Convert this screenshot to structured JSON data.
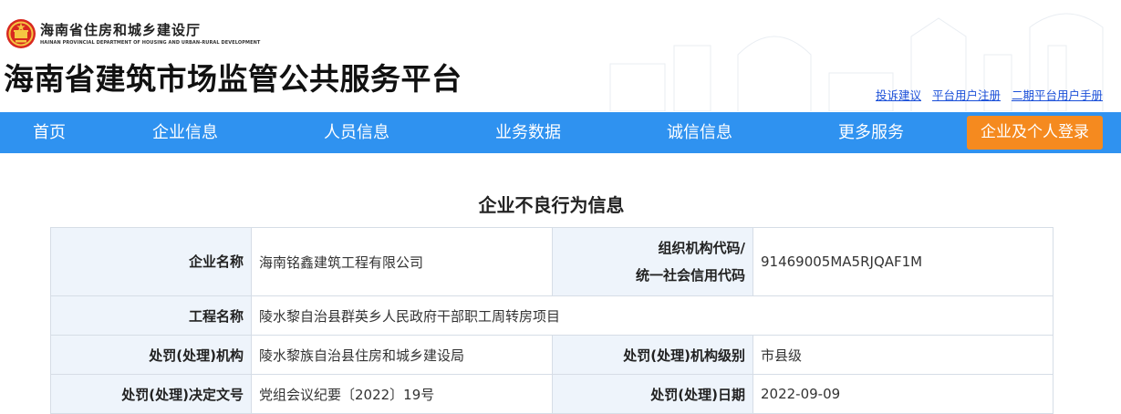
{
  "header": {
    "dept_name_cn": "海南省住房和城乡建设厅",
    "dept_name_en": "HAINAN PROVINCIAL DEPARTMENT OF HOUSING AND URBAN-RURAL DEVELOPMENT",
    "site_title": "海南省建筑市场监管公共服务平台",
    "links": [
      "投诉建议",
      "平台用户注册",
      "二期平台用户手册"
    ]
  },
  "nav": {
    "items": [
      "首页",
      "企业信息",
      "人员信息",
      "业务数据",
      "诚信信息",
      "更多服务"
    ],
    "login_label": "企业及个人登录"
  },
  "main": {
    "title": "企业不良行为信息",
    "fields": {
      "company_name_label": "企业名称",
      "company_name": "海南铭鑫建筑工程有限公司",
      "org_code_label_line1": "组织机构代码/",
      "org_code_label_line2": "统一社会信用代码",
      "org_code": "91469005MA5RJQAF1M",
      "project_name_label": "工程名称",
      "project_name": "陵水黎自治县群英乡人民政府干部职工周转房项目",
      "penalty_org_label": "处罚(处理)机构",
      "penalty_org": "陵水黎族自治县住房和城乡建设局",
      "penalty_org_level_label": "处罚(处理)机构级别",
      "penalty_org_level": "市县级",
      "decision_no_label": "处罚(处理)决定文号",
      "decision_no": "党组会议纪要〔2022〕19号",
      "penalty_date_label": "处罚(处理)日期",
      "penalty_date": "2022-09-09"
    }
  },
  "colors": {
    "nav_bg": "#2f92f0",
    "login_bg": "#f58a1f",
    "label_bg": "#eef4fb",
    "link": "#1a4fd8"
  }
}
